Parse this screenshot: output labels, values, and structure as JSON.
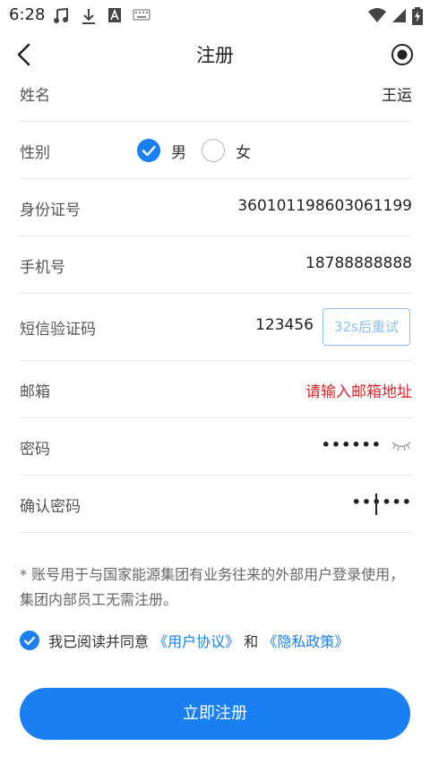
{
  "status_bar": {
    "time": "6:28",
    "left_icons": [
      "music-icon",
      "download-icon",
      "font-a-icon",
      "keyboard-icon"
    ],
    "right_icons": [
      "wifi-icon",
      "signal-icon",
      "battery-icon"
    ]
  },
  "nav": {
    "title": "注册",
    "back_icon": "chevron-left-icon",
    "right_icon": "record-icon"
  },
  "form": {
    "name": {
      "label": "姓名",
      "value": "王运"
    },
    "gender": {
      "label": "性别",
      "options": [
        "男",
        "女"
      ],
      "selected": "男"
    },
    "id_number": {
      "label": "身份证号",
      "value": "360101198603061199"
    },
    "phone": {
      "label": "手机号",
      "value": "18788888888"
    },
    "sms_code": {
      "label": "短信验证码",
      "value": "123456",
      "button": "32s后重试"
    },
    "email": {
      "label": "邮箱",
      "placeholder": "请输入邮箱地址"
    },
    "password": {
      "label": "密码",
      "value": "••••••",
      "toggle_icon": "eye-closed-icon"
    },
    "confirm_password": {
      "label": "确认密码",
      "value": "••••••"
    }
  },
  "note": "* 账号用于与国家能源集团有业务往来的外部用户登录使用，集团内部员工无需注册。",
  "agreement": {
    "checked": true,
    "prefix": "我已阅读并同意",
    "user_agreement": "《用户协议》",
    "conjunction": "和",
    "privacy_policy": "《隐私政策》"
  },
  "submit_label": "立即注册",
  "colors": {
    "accent": "#1a7ff0",
    "error": "#e0242c",
    "disabled_button": "#8ec0f5"
  }
}
